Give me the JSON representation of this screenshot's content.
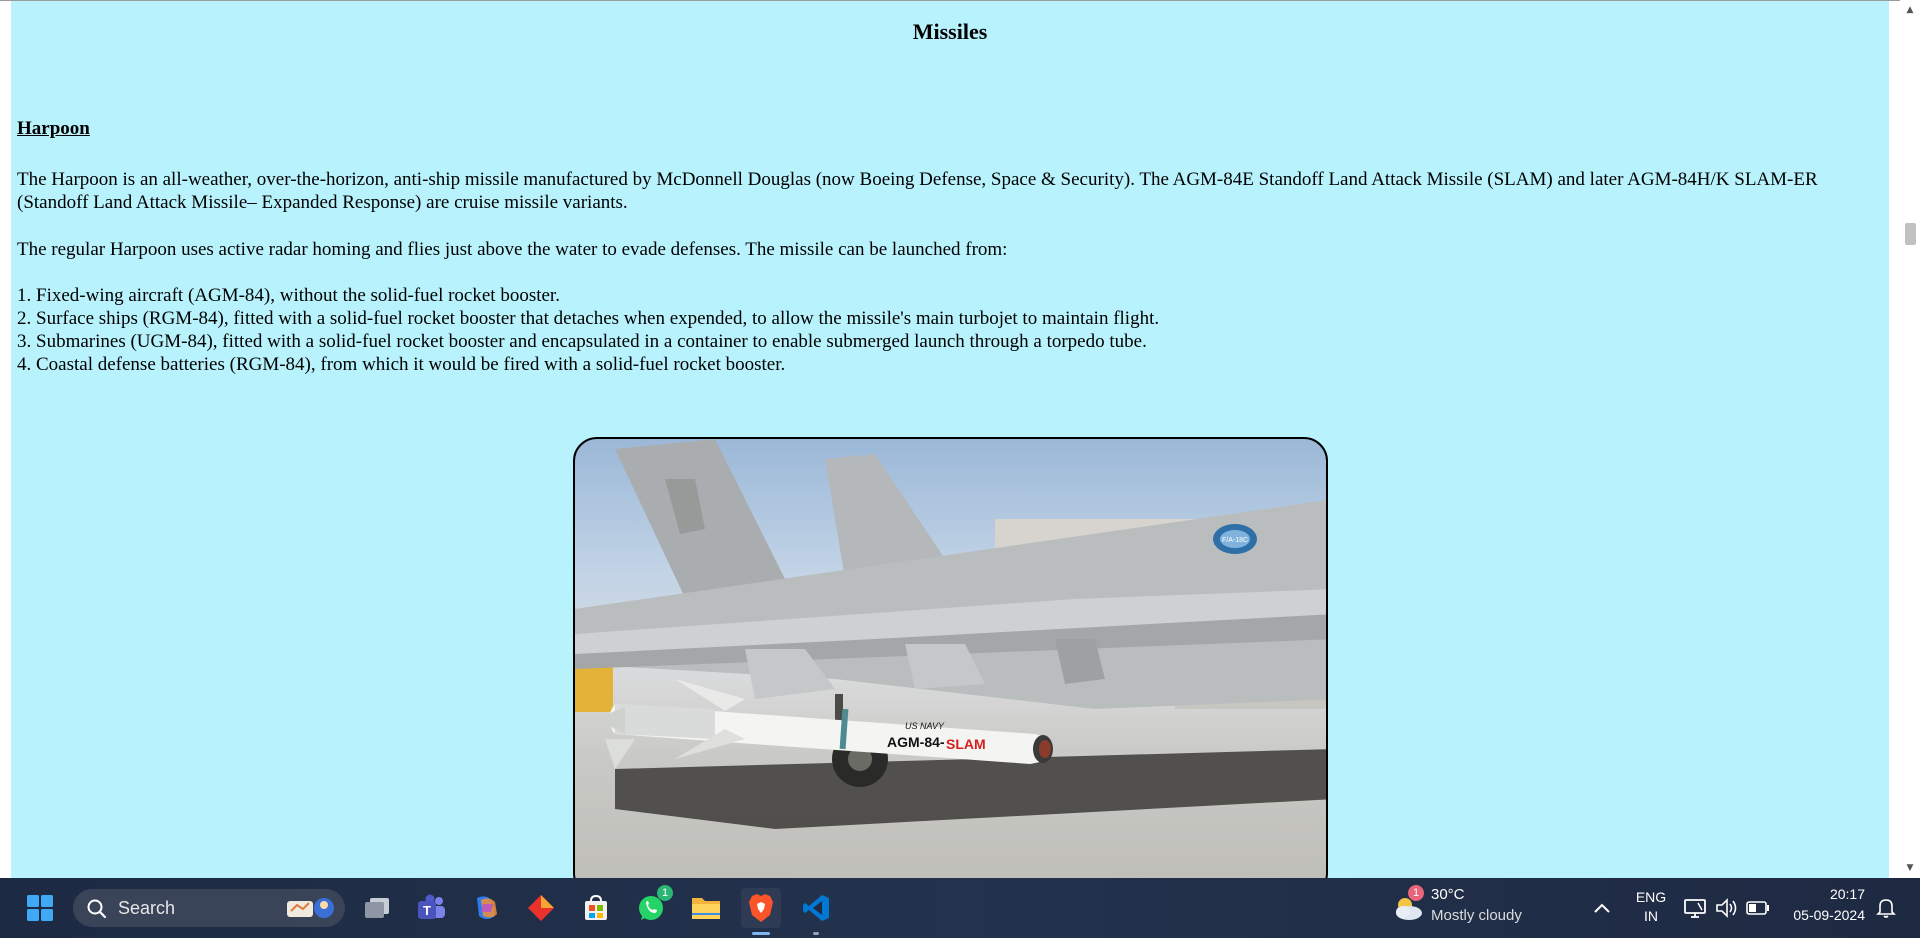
{
  "page": {
    "title": "Missiles",
    "section": {
      "heading": "Harpoon",
      "paragraph1": "The Harpoon is an all-weather, over-the-horizon, anti-ship missile manufactured by McDonnell Douglas (now Boeing Defense, Space & Security). The AGM-84E Standoff Land Attack Missile (SLAM) and later AGM-84H/K SLAM-ER (Standoff Land Attack Missile– Expanded Response) are cruise missile variants.",
      "paragraph2": "The regular Harpoon uses active radar homing and flies just above the water to evade defenses. The missile can be launched from:",
      "launch_platforms": [
        "1. Fixed-wing aircraft (AGM-84), without the solid-fuel rocket booster.",
        "2. Surface ships (RGM-84), fitted with a solid-fuel rocket booster that detaches when expended, to allow the missile's main turbojet to maintain flight.",
        "3. Submarines (UGM-84), fitted with a solid-fuel rocket booster and encapsulated in a container to enable submerged launch through a torpedo tube.",
        "4. Coastal defense batteries (RGM-84), from which it would be fired with a solid-fuel rocket booster."
      ],
      "image": {
        "missile_marking_top": "US NAVY",
        "missile_marking_main": "AGM-84-",
        "missile_marking_accent": "SLAM",
        "jet_roundel_text": "F/A-18C"
      }
    }
  },
  "taskbar": {
    "search_label": "Search",
    "whatsapp_badge": "1",
    "weather_badge": "1",
    "weather_temp": "30°C",
    "weather_desc": "Mostly cloudy",
    "language_line1": "ENG",
    "language_line2": "IN",
    "time": "20:17",
    "date": "05-09-2024"
  },
  "colors": {
    "page_background": "#b7f2fd",
    "taskbar_background": "#1f2b44",
    "slam_red": "#d32020"
  },
  "icons": [
    "windows-start-icon",
    "search-icon",
    "task-view-icon",
    "teams-icon",
    "copilot-icon",
    "red-app-icon",
    "store-icon",
    "whatsapp-icon",
    "file-explorer-icon",
    "brave-icon",
    "vscode-icon",
    "weather-icon",
    "chevron-up-icon",
    "network-icon",
    "volume-icon",
    "battery-icon",
    "notification-bell-icon"
  ]
}
